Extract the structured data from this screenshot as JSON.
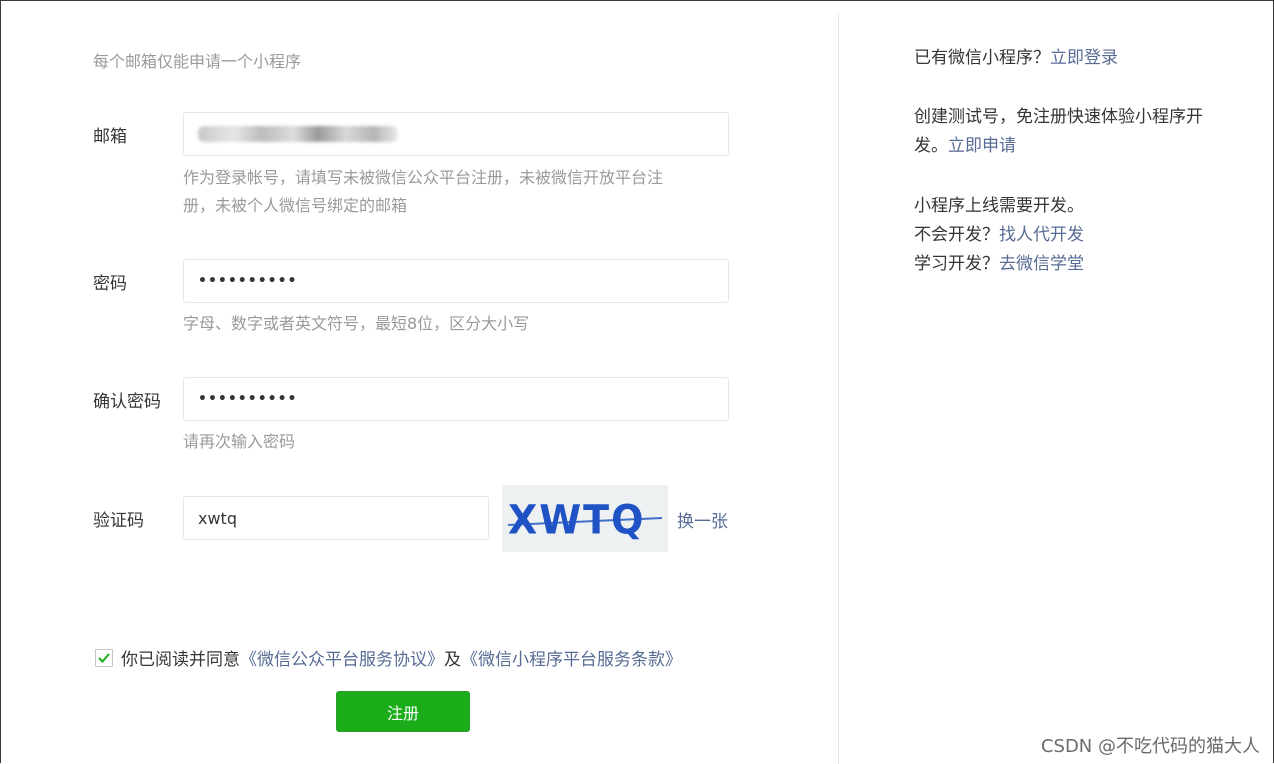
{
  "form": {
    "notice": "每个邮箱仅能申请一个小程序",
    "email": {
      "label": "邮箱",
      "hint_line1": "作为登录帐号，请填写未被微信公众平台注册，未被微信开放平台注",
      "hint_line2": "册，未被个人微信号绑定的邮箱"
    },
    "password": {
      "label": "密码",
      "value": "••••••••••",
      "hint": "字母、数字或者英文符号，最短8位，区分大小写"
    },
    "confirm_password": {
      "label": "确认密码",
      "value": "••••••••••",
      "hint": "请再次输入密码"
    },
    "captcha": {
      "label": "验证码",
      "value": "xwtq",
      "image_text": "XWTQ",
      "refresh_link": "换一张"
    },
    "agreement": {
      "prefix": "你已阅读并同意",
      "link1": "《微信公众平台服务协议》",
      "middle": "及",
      "link2": "《微信小程序平台服务条款》",
      "checked": true
    },
    "submit_label": "注册"
  },
  "side": {
    "login_prefix": "已有微信小程序？",
    "login_link": "立即登录",
    "test_text_line1": "创建测试号，免注册快速体验小程序开",
    "test_text_line2": "发。",
    "test_link": "立即申请",
    "dev_text": "小程序上线需要开发。",
    "dev_prefix1": "不会开发？",
    "dev_link1": "找人代开发",
    "dev_prefix2": "学习开发？",
    "dev_link2": "去微信学堂"
  },
  "watermark": "CSDN @不吃代码的猫大人",
  "colors": {
    "link": "#576b95",
    "primary_button": "#1aad19",
    "hint": "#9a9a9a",
    "check": "#1aad19"
  }
}
